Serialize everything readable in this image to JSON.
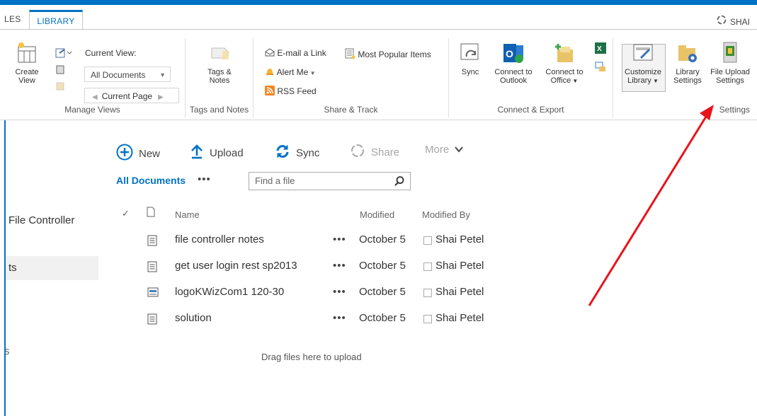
{
  "tabs": {
    "files": "LES",
    "library": "LIBRARY",
    "share": "SHAI"
  },
  "ribbon": {
    "manage_views": {
      "label": "Manage Views",
      "create_view": [
        "Create",
        "View"
      ],
      "current_view_label": "Current View:",
      "current_view_value": "All Documents",
      "current_page": "Current Page"
    },
    "tags_notes": {
      "label": "Tags and Notes",
      "button": [
        "Tags &",
        "Notes"
      ]
    },
    "share_track": {
      "label": "Share & Track",
      "email_link": "E-mail a Link",
      "alert_me": "Alert Me",
      "rss_feed": "RSS Feed",
      "most_popular": "Most Popular Items"
    },
    "connect_export": {
      "label": "Connect & Export",
      "sync": "Sync",
      "outlook": [
        "Connect to",
        "Outlook"
      ],
      "office": [
        "Connect to",
        "Office"
      ]
    },
    "settings": {
      "label": "Settings",
      "customize": [
        "Customize",
        "Library"
      ],
      "library_settings": [
        "Library",
        "Settings"
      ],
      "file_upload": [
        "File Upload",
        "Settings"
      ]
    }
  },
  "toolbar": {
    "new": "New",
    "upload": "Upload",
    "sync": "Sync",
    "share": "Share",
    "more": "More",
    "view": "All Documents",
    "ellipsis": "•••",
    "search_placeholder": "Find a file"
  },
  "nav": {
    "item1": "File Controller",
    "item2": "ts",
    "item3": "s"
  },
  "list": {
    "headers": {
      "name": "Name",
      "modified": "Modified",
      "modified_by": "Modified By"
    },
    "rows": [
      {
        "name": "file controller notes",
        "modified": "October 5",
        "by": "Shai Petel",
        "icon": "text-file-icon"
      },
      {
        "name": "get user login rest sp2013",
        "modified": "October 5",
        "by": "Shai Petel",
        "icon": "text-file-icon"
      },
      {
        "name": "logoKWizCom1 120-30",
        "modified": "October 5",
        "by": "Shai Petel",
        "icon": "image-file-icon"
      },
      {
        "name": "solution",
        "modified": "October 5",
        "by": "Shai Petel",
        "icon": "text-file-icon"
      }
    ],
    "drag_text": "Drag files here to upload"
  },
  "colors": {
    "accent": "#0072c6",
    "arrow": "#e8141b"
  }
}
